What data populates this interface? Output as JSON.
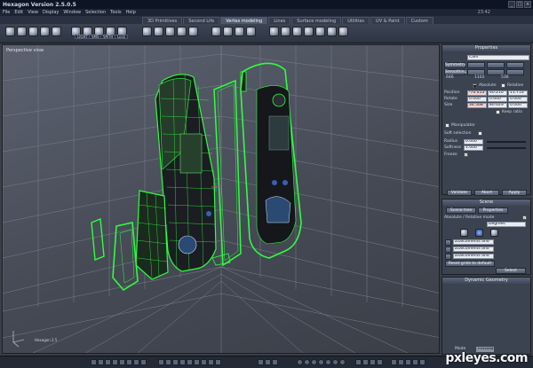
{
  "app": {
    "title": "Hexagon Version 2.5.0.5",
    "clock": "23:42"
  },
  "menu": [
    "File",
    "Edit",
    "View",
    "Display",
    "Window",
    "Selection",
    "Tools",
    "Help"
  ],
  "tabs": [
    {
      "label": "3D Primitives",
      "active": false
    },
    {
      "label": "Second Life",
      "active": false
    },
    {
      "label": "Vertex modeling",
      "active": true
    },
    {
      "label": "Lines",
      "active": false
    },
    {
      "label": "Surface modeling",
      "active": false
    },
    {
      "label": "Utilities",
      "active": false
    },
    {
      "label": "UV & Paint",
      "active": false
    },
    {
      "label": "Custom",
      "active": false
    }
  ],
  "toolbar_labels": [
    "LIGHT",
    "SMS",
    "SMTH",
    "Lock"
  ],
  "viewport": {
    "label": "Perspective view",
    "logo": "Hexagon 2.5"
  },
  "properties": {
    "header": "Properties",
    "name": "Cam",
    "sym_label": "Symmetry",
    "bevel_label": "Smoothing",
    "lines_labels": [
      "646",
      "1102",
      "536"
    ],
    "absolute": "Absolute",
    "relative": "Relative",
    "position_label": "Position",
    "position": [
      "-70.413",
      "40.210",
      "11.753"
    ],
    "rotate_label": "Rotate",
    "rotate": [
      "0.000",
      "0.000",
      "0.000"
    ],
    "size_label": "Size",
    "size": [
      "34.568",
      "80.629",
      "0.000"
    ],
    "keep_ratio": "Keep ratio",
    "manipulator": "Manipulator",
    "soft_selection": "Soft selection",
    "radius_label": "Radius",
    "radius": "0.000",
    "softness_label": "Softness",
    "softness": "1.000",
    "freeze_label": "Freeze",
    "validate": "Validate",
    "abort": "Abort",
    "apply": "Apply"
  },
  "scene": {
    "header": "Scene",
    "tabs": [
      "Scene tree",
      "Properties"
    ],
    "mode_label": "Absolute / Relative mode",
    "selector": "Degrees",
    "rows": [
      "ZDocuments and",
      "ZDocuments and",
      "ZDocuments and"
    ],
    "reset_label": "Reset grids to default",
    "select": "Select"
  },
  "dynamic": {
    "header": "Dynamic Geometry"
  },
  "status": {
    "mode_label": "Mode",
    "mode_value": "Preview"
  },
  "watermark": "pxleyes.com",
  "colors": {
    "wire": "#2dff3c",
    "bg": "#4a4f5a",
    "accent": "#5a6579"
  }
}
